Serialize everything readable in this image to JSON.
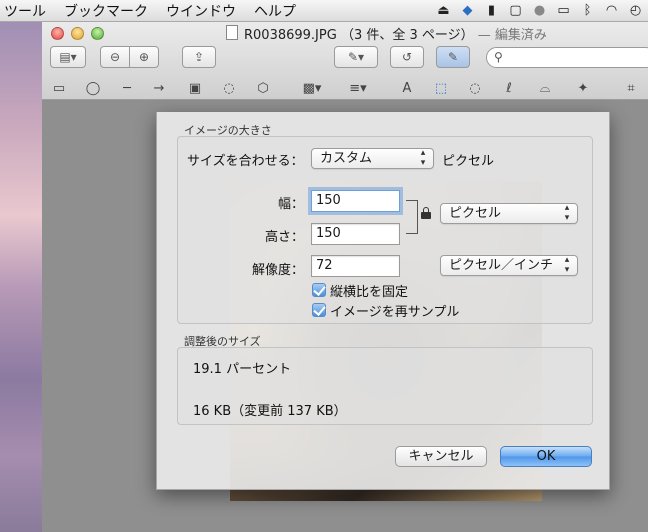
{
  "menubar": {
    "items": [
      "ツール",
      "ブックマーク",
      "ウインドウ",
      "ヘルプ"
    ],
    "status_icons": [
      "lock-screen-icon",
      "dropbox-icon",
      "bookmark-icon",
      "square-icon",
      "cursor-icon",
      "airplay-icon",
      "bluetooth-icon",
      "wifi-icon",
      "time-machine-icon"
    ]
  },
  "window": {
    "filename": "R0038699.JPG",
    "pages": "（3 件、全 3 ページ）",
    "edited": "— 編集済み"
  },
  "dialog": {
    "image_size_label": "イメージの大きさ",
    "fit_label": "サイズを合わせる：",
    "fit_value": "カスタム",
    "fit_unit": "ピクセル",
    "width_label": "幅：",
    "width_value": "150",
    "height_label": "高さ：",
    "height_value": "150",
    "resolution_label": "解像度：",
    "resolution_value": "72",
    "size_unit": "ピクセル",
    "resolution_unit": "ピクセル／インチ",
    "scale_checkbox": "縦横比を固定",
    "resample_checkbox": "イメージを再サンプル",
    "result_label": "調整後のサイズ",
    "result_percent": "19.1 パーセント",
    "result_size": "16 KB（変更前 137 KB）",
    "cancel": "キャンセル",
    "ok": "OK"
  },
  "colors": {
    "accent": "#4e96ea",
    "focus_ring": "#6ca0dc"
  }
}
